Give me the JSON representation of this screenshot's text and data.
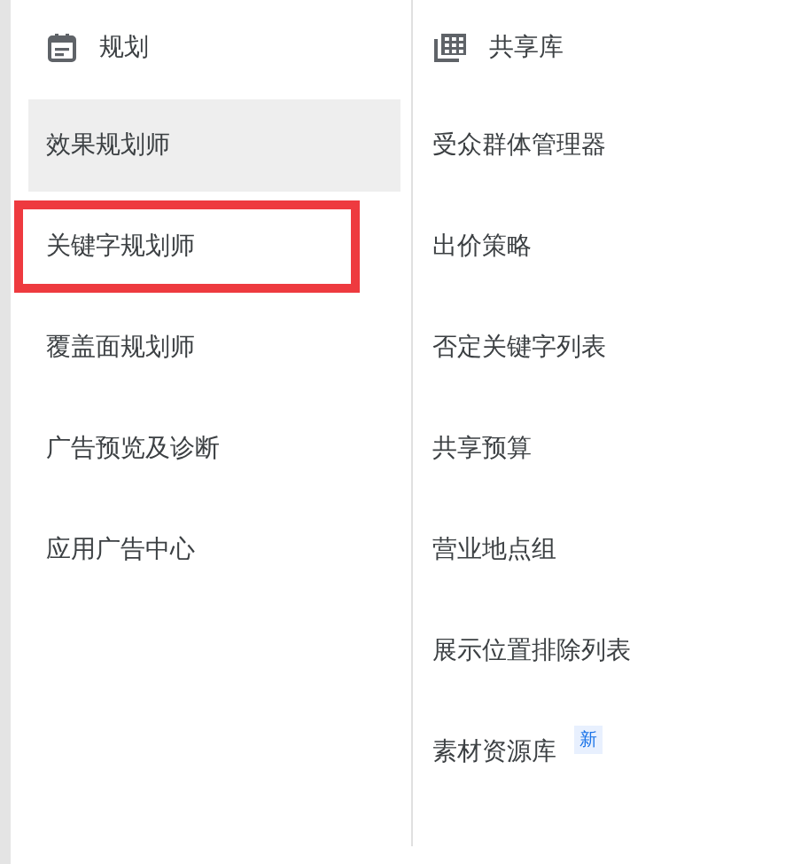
{
  "columns": [
    {
      "title": "规划",
      "items": [
        {
          "label": "效果规划师",
          "selected": true,
          "highlighted": false
        },
        {
          "label": "关键字规划师",
          "selected": false,
          "highlighted": true
        },
        {
          "label": "覆盖面规划师",
          "selected": false,
          "highlighted": false
        },
        {
          "label": "广告预览及诊断",
          "selected": false,
          "highlighted": false
        },
        {
          "label": "应用广告中心",
          "selected": false,
          "highlighted": false
        }
      ]
    },
    {
      "title": "共享库",
      "items": [
        {
          "label": "受众群体管理器",
          "selected": false,
          "highlighted": false
        },
        {
          "label": "出价策略",
          "selected": false,
          "highlighted": false
        },
        {
          "label": "否定关键字列表",
          "selected": false,
          "highlighted": false
        },
        {
          "label": "共享预算",
          "selected": false,
          "highlighted": false
        },
        {
          "label": "营业地点组",
          "selected": false,
          "highlighted": false
        },
        {
          "label": "展示位置排除列表",
          "selected": false,
          "highlighted": false
        },
        {
          "label": "素材资源库",
          "selected": false,
          "highlighted": false,
          "badge": "新"
        }
      ]
    }
  ]
}
